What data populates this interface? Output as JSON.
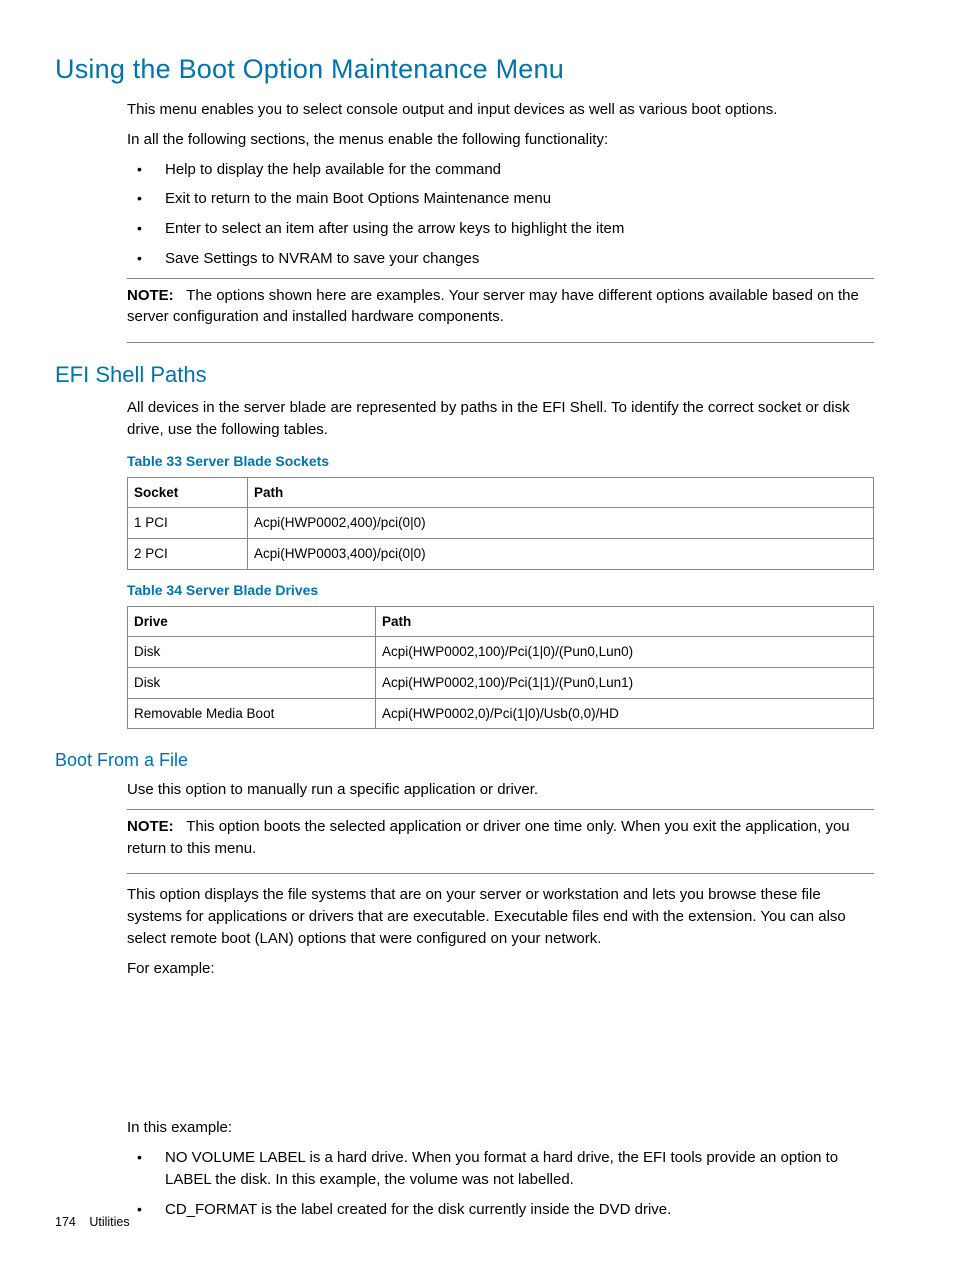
{
  "h1": "Using the Boot Option Maintenance Menu",
  "intro1": "This menu enables you to select console output and input devices as well as various boot options.",
  "intro2": "In all the following sections, the menus enable the following functionality:",
  "bullets_top": [
    "Help to display the help available for the command",
    "Exit to return to the main Boot Options Maintenance menu",
    "Enter to select an item after using the arrow keys to highlight the item",
    "Save Settings to NVRAM to save your changes"
  ],
  "note1_label": "NOTE:",
  "note1_text": "The options shown here are examples. Your server may have different options available based on the server configuration and installed hardware components.",
  "h2_efi": "EFI Shell Paths",
  "efi_intro": "All devices in the server blade are represented by paths in the EFI Shell. To identify the correct socket or disk drive, use the following tables.",
  "table33_caption": "Table 33 Server Blade Sockets",
  "table33": {
    "headers": [
      "Socket",
      "Path"
    ],
    "rows": [
      [
        "1 PCI",
        "Acpi(HWP0002,400)/pci(0|0)"
      ],
      [
        "2 PCI",
        "Acpi(HWP0003,400)/pci(0|0)"
      ]
    ]
  },
  "table34_caption": "Table 34 Server Blade Drives",
  "table34": {
    "headers": [
      "Drive",
      "Path"
    ],
    "rows": [
      [
        "Disk",
        "Acpi(HWP0002,100)/Pci(1|0)/(Pun0,Lun0)"
      ],
      [
        "Disk",
        "Acpi(HWP0002,100)/Pci(1|1)/(Pun0,Lun1)"
      ],
      [
        "Removable Media Boot",
        "Acpi(HWP0002,0)/Pci(1|0)/Usb(0,0)/HD"
      ]
    ]
  },
  "h3_boot": "Boot From a File",
  "boot_p1": "Use this option to manually run a specific application or driver.",
  "note2_label": "NOTE:",
  "note2_text": "This option boots the selected application or driver one time only. When you exit the application, you return to this menu.",
  "boot_p2": "This option displays the file systems that are on your server or workstation and lets you browse these file systems for applications or drivers that are executable. Executable files end with the extension. You can also select remote boot (LAN) options that were configured on your network.",
  "boot_p3": "For example:",
  "boot_p4": "In this example:",
  "bullets_bottom": [
    "NO VOLUME LABEL is a hard drive. When you format a hard drive, the EFI tools provide an option to LABEL the disk. In this example, the volume was not labelled.",
    "CD_FORMAT is the label created for the disk currently inside the DVD drive."
  ],
  "footer_page": "174",
  "footer_section": "Utilities"
}
